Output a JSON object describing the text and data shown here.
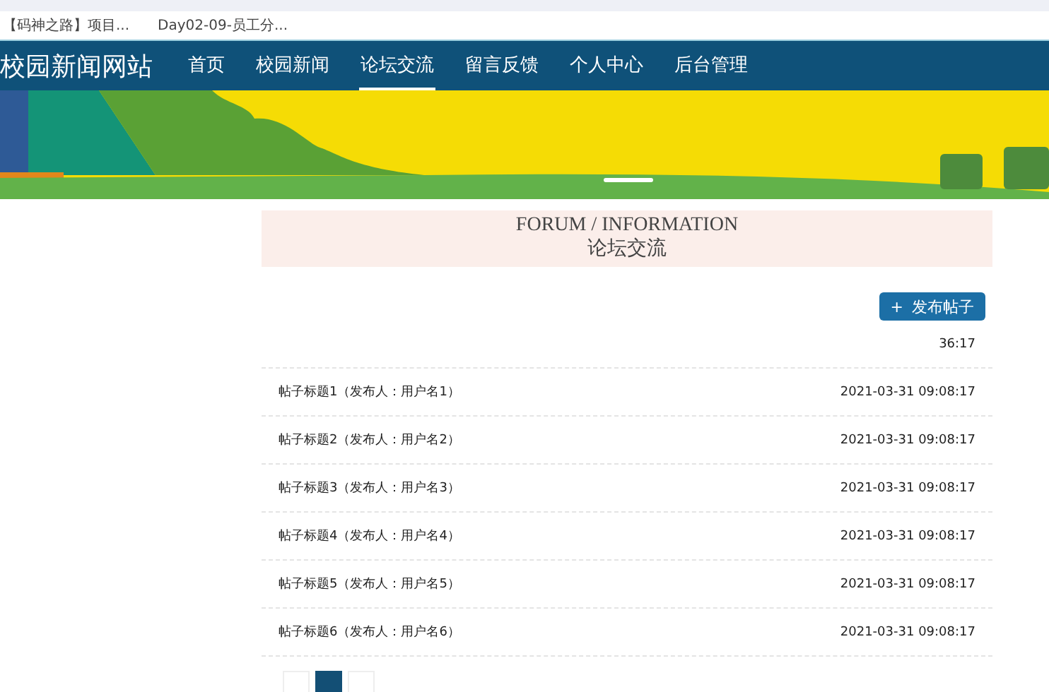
{
  "bookmarks": [
    {
      "label": "【码神之路】项目..."
    },
    {
      "label": "Day02-09-员工分..."
    }
  ],
  "site": {
    "title": "校园新闻网站"
  },
  "nav": [
    {
      "label": "首页",
      "selected": false
    },
    {
      "label": "校园新闻",
      "selected": false
    },
    {
      "label": "论坛交流",
      "selected": true
    },
    {
      "label": "留言反馈",
      "selected": false
    },
    {
      "label": "个人中心",
      "selected": false
    },
    {
      "label": "后台管理",
      "selected": false
    }
  ],
  "section": {
    "title_en": "FORUM / INFORMATION",
    "title_cn": "论坛交流"
  },
  "post_button": {
    "icon": "+",
    "label": "发布帖子"
  },
  "posts": [
    {
      "time": "36:17"
    },
    {
      "title": "帖子标题1（发布人：用户名1）",
      "time": "2021-03-31 09:08:17"
    },
    {
      "title": "帖子标题2（发布人：用户名2）",
      "time": "2021-03-31 09:08:17"
    },
    {
      "title": "帖子标题3（发布人：用户名3）",
      "time": "2021-03-31 09:08:17"
    },
    {
      "title": "帖子标题4（发布人：用户名4）",
      "time": "2021-03-31 09:08:17"
    },
    {
      "title": "帖子标题5（发布人：用户名5）",
      "time": "2021-03-31 09:08:17"
    },
    {
      "title": "帖子标题6（发布人：用户名6）",
      "time": "2021-03-31 09:08:17"
    }
  ],
  "pagination": [
    {
      "selected": false
    },
    {
      "selected": true
    },
    {
      "selected": false
    }
  ]
}
